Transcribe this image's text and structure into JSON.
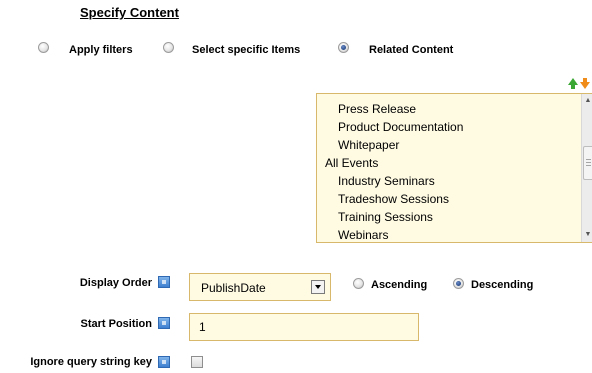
{
  "section": {
    "title": "Specify Content"
  },
  "content_mode": {
    "options": [
      {
        "label": "Apply filters",
        "selected": false
      },
      {
        "label": "Select specific Items",
        "selected": false
      },
      {
        "label": "Related Content",
        "selected": true
      }
    ]
  },
  "reorder_icons": [
    "move-up-icon",
    "move-down-icon"
  ],
  "content_list": {
    "items": [
      {
        "label": "Press Release",
        "indent": 1
      },
      {
        "label": "Product Documentation",
        "indent": 1
      },
      {
        "label": "Whitepaper",
        "indent": 1
      },
      {
        "label": "All Events",
        "indent": 0
      },
      {
        "label": "Industry Seminars",
        "indent": 1
      },
      {
        "label": "Tradeshow Sessions",
        "indent": 1
      },
      {
        "label": "Training Sessions",
        "indent": 1
      },
      {
        "label": "Webinars",
        "indent": 1
      }
    ]
  },
  "display_order": {
    "label": "Display Order",
    "value": "PublishDate",
    "sort": [
      {
        "label": "Ascending",
        "selected": false
      },
      {
        "label": "Descending",
        "selected": true
      }
    ]
  },
  "start_position": {
    "label": "Start Position",
    "value": "1"
  },
  "ignore_query": {
    "label": "Ignore query string key",
    "checked": false
  },
  "colors": {
    "field_bg": "#fffbe3",
    "field_border": "#d8b86a",
    "help_icon": "#3e7fd0"
  }
}
